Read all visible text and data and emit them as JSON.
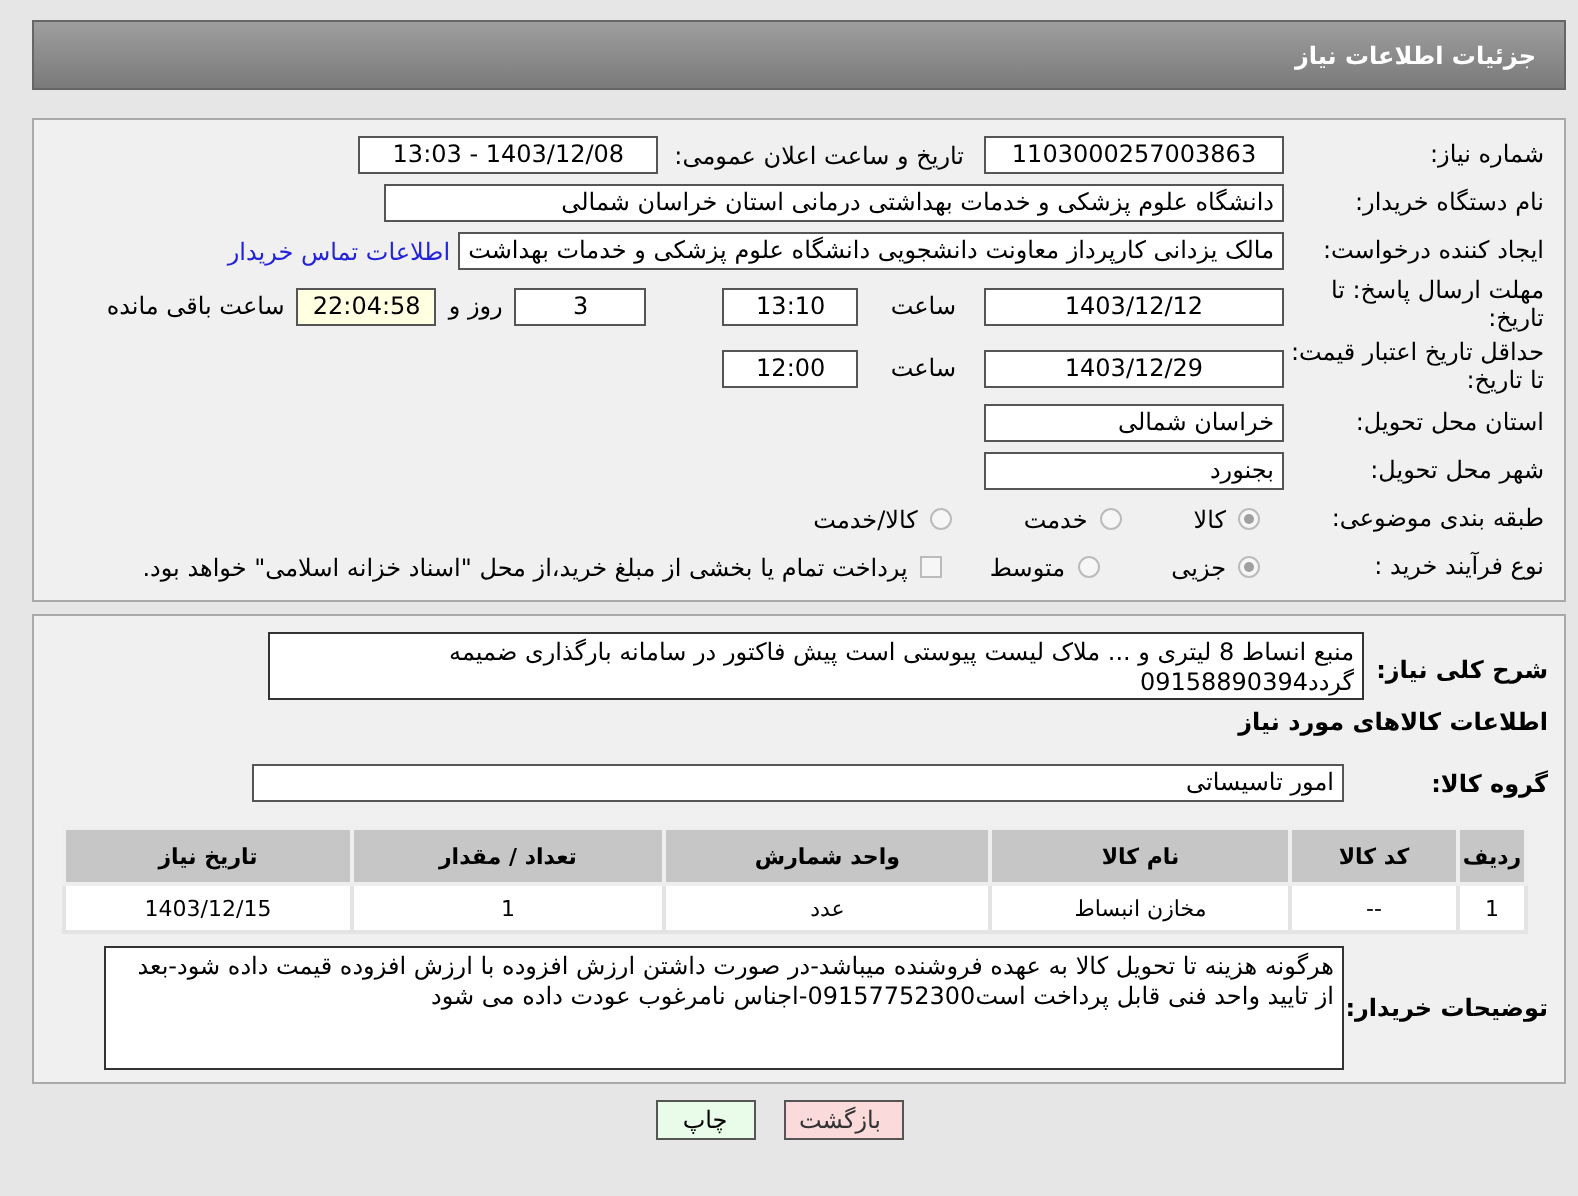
{
  "header": {
    "title": "جزئیات اطلاعات نیاز"
  },
  "need_number": {
    "label": "شماره نیاز:",
    "value": "1103000257003863"
  },
  "announce": {
    "label": "تاریخ و ساعت اعلان عمومی:",
    "value": "1403/12/08 - 13:03"
  },
  "buyer_org": {
    "label": "نام دستگاه خریدار:",
    "value": "دانشگاه علوم پزشکی و خدمات بهداشتی درمانی استان خراسان شمالی"
  },
  "creator": {
    "label": "ایجاد کننده درخواست:",
    "value": "مالک یزدانی کارپرداز معاونت دانشجویی دانشگاه علوم پزشکی و خدمات بهداشت",
    "link": "اطلاعات تماس خریدار"
  },
  "deadline": {
    "label": "مهلت ارسال پاسخ: تا تاریخ:",
    "date": "1403/12/12",
    "time_label": "ساعت",
    "time": "13:10",
    "days": "3",
    "days_label": "روز و",
    "remaining": "22:04:58",
    "remaining_label": "ساعت باقی مانده"
  },
  "validity": {
    "label": "حداقل تاریخ اعتبار قیمت: تا تاریخ:",
    "date": "1403/12/29",
    "time_label": "ساعت",
    "time": "12:00"
  },
  "province": {
    "label": "استان محل تحویل:",
    "value": "خراسان شمالی"
  },
  "city": {
    "label": "شهر محل تحویل:",
    "value": "بجنورد"
  },
  "category": {
    "label": "طبقه بندی موضوعی:",
    "options": [
      {
        "label": "کالا",
        "selected": true
      },
      {
        "label": "خدمت",
        "selected": false
      },
      {
        "label": "کالا/خدمت",
        "selected": false
      }
    ]
  },
  "process": {
    "label": "نوع فرآیند خرید :",
    "options": [
      {
        "label": "جزیی",
        "selected": true
      },
      {
        "label": "متوسط",
        "selected": false
      }
    ],
    "payment": {
      "label": "پرداخت تمام یا بخشی از مبلغ خرید،از محل \"اسناد خزانه اسلامی\" خواهد بود.",
      "checked": false
    }
  },
  "description": {
    "label": "شرح کلی نیاز:",
    "value": "منبع انساط 8 لیتری و ... ملاک لیست پیوستی است پیش فاکتور در سامانه بارگذاری ضمیمه گردد09158890394"
  },
  "goods_heading": "اطلاعات کالاهای مورد نیاز",
  "goods_group": {
    "label": "گروه کالا:",
    "value": "امور تاسیساتی"
  },
  "table": {
    "columns": [
      "ردیف",
      "کد کالا",
      "نام کالا",
      "واحد شمارش",
      "تعداد / مقدار",
      "تاریخ نیاز"
    ],
    "rows": [
      [
        "1",
        "--",
        "مخازن انبساط",
        "عدد",
        "1",
        "1403/12/15"
      ]
    ]
  },
  "buyer_notes": {
    "label": "توضیحات خریدار:",
    "value": "هرگونه هزینه تا تحویل کالا به عهده فروشنده میباشد-در صورت داشتن ارزش افزوده با ارزش افزوده قیمت داده شود-بعد از تایید واحد فنی قابل پرداخت است09157752300-اجناس نامرغوب عودت داده می شود"
  },
  "buttons": [
    {
      "kind": "back",
      "label": "بازگشت"
    },
    {
      "kind": "print",
      "label": "چاپ"
    }
  ]
}
